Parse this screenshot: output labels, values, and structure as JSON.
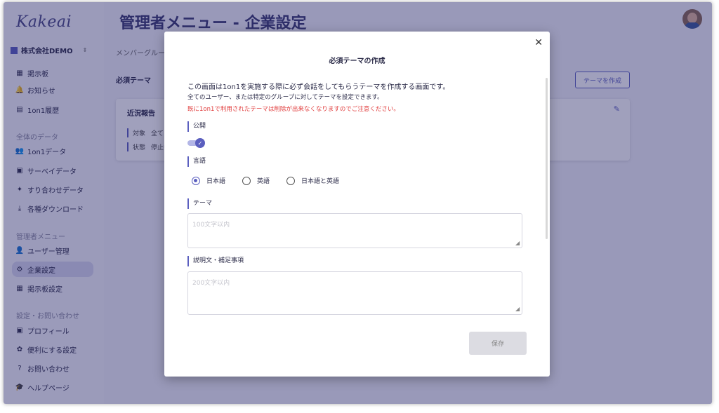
{
  "sidebar": {
    "logo": "Kakeai",
    "company": "株式会社DEMO",
    "items": [
      {
        "label": "掲示板",
        "icon": "board-icon"
      },
      {
        "label": "お知らせ",
        "icon": "bell-icon"
      },
      {
        "label": "1on1履歴",
        "icon": "history-icon"
      },
      {
        "label": "1on1データ",
        "icon": "people-icon"
      },
      {
        "label": "サーベイデータ",
        "icon": "survey-icon"
      },
      {
        "label": "すり合わせデータ",
        "icon": "handshake-icon"
      },
      {
        "label": "各種ダウンロード",
        "icon": "download-icon"
      },
      {
        "label": "ユーザー管理",
        "icon": "users-icon"
      },
      {
        "label": "企業設定",
        "icon": "company-settings-icon"
      },
      {
        "label": "掲示板設定",
        "icon": "board-settings-icon"
      },
      {
        "label": "プロフィール",
        "icon": "profile-icon"
      },
      {
        "label": "便利にする設定",
        "icon": "gear-icon"
      },
      {
        "label": "お問い合わせ",
        "icon": "help-icon"
      },
      {
        "label": "ヘルプページ",
        "icon": "graduation-icon"
      }
    ],
    "sections": {
      "data": "全体のデータ",
      "admin": "管理者メニュー",
      "settings": "設定・お問い合わせ"
    }
  },
  "main": {
    "title": "管理者メニュー - 企業設定",
    "breadcrumb": "メンバーグルー",
    "section_title": "必須テーマ",
    "create_button": "テーマを作成",
    "card": {
      "title": "近況報告",
      "row1_label": "対象",
      "row1_value": "全て",
      "row2_label": "状態",
      "row2_value": "停止中"
    }
  },
  "modal": {
    "title": "必須テーマの作成",
    "close": "✕",
    "description": "この画面は1on1を実施する際に必ず会話をしてもらうテーマを作成する画面です。",
    "description_sub": "全てのユーザー、または特定のグループに対してテーマを設定できます。",
    "warning": "既に1on1で利用されたテーマは削除が出来なくなりますのでご注意ください。",
    "public_label": "公開",
    "public_enabled": true,
    "language_label": "言語",
    "language_options": [
      "日本語",
      "英語",
      "日本語と英語"
    ],
    "language_selected": "日本語",
    "theme_label": "テーマ",
    "theme_placeholder": "100文字以内",
    "notes_label": "説明文・補足事項",
    "notes_placeholder": "200文字以内",
    "save_button": "保存"
  },
  "colors": {
    "accent": "#5b5fbf",
    "warning": "#e03a3a",
    "overlay": "#1c1c5f"
  }
}
